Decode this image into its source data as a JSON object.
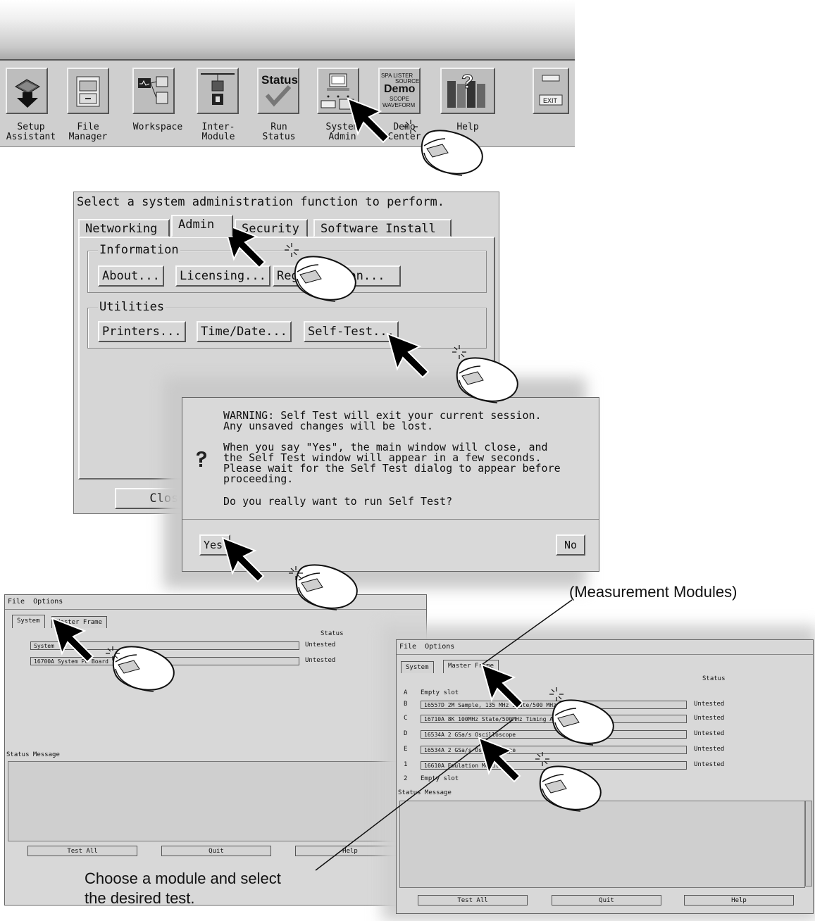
{
  "toolbar": {
    "buttons": [
      {
        "label": "Setup\nAssistant",
        "icon": "setup-assistant-icon"
      },
      {
        "label": "File\nManager",
        "icon": "file-manager-icon"
      },
      {
        "label": "Workspace",
        "icon": "workspace-icon"
      },
      {
        "label": "Inter-\nModule",
        "icon": "inter-module-icon"
      },
      {
        "label": "Run\nStatus",
        "icon": "status-icon",
        "icon_text": "Status"
      },
      {
        "label": "System\nAdmin",
        "icon": "system-admin-icon"
      },
      {
        "label": "Demo\nCenter",
        "icon": "demo-icon",
        "icon_text": "Demo",
        "icon_lines": [
          "SPA LISTER",
          "SOURCE",
          "SCOPE",
          "WAVEFORM"
        ]
      },
      {
        "label": "Help",
        "icon": "help-books-icon"
      }
    ],
    "exit_label": "EXIT"
  },
  "admin": {
    "prompt": "Select a system administration function to perform.",
    "tabs": [
      "Networking",
      "Admin",
      "Security",
      "Software Install"
    ],
    "information": {
      "title": "Information",
      "buttons": [
        "About...",
        "Licensing...",
        "Registration..."
      ]
    },
    "utilities": {
      "title": "Utilities",
      "buttons": [
        "Printers...",
        "Time/Date...",
        "Self-Test..."
      ]
    },
    "close_label": "Close"
  },
  "warning": {
    "lines1": [
      "WARNING: Self Test will exit your current session.",
      "Any unsaved changes will be lost."
    ],
    "lines2": [
      "When you say \"Yes\", the main window will close, and",
      "the Self Test window will appear in a few seconds.",
      "Please wait for the Self Test dialog to appear before",
      "proceeding."
    ],
    "question": "Do you really want to run Self Test?",
    "yes_label": "Yes",
    "no_label": "No"
  },
  "selftest_system": {
    "menu": [
      "File",
      "Options"
    ],
    "tabs": [
      "System",
      "Master Frame"
    ],
    "status_header": "Status",
    "rows": [
      {
        "name": "System",
        "status": "Untested"
      },
      {
        "name": "16700A System PC Board",
        "status": "Untested"
      }
    ],
    "status_message_label": "Status Message",
    "buttons": [
      "Test All",
      "Quit",
      "Help"
    ]
  },
  "selftest_frame": {
    "menu": [
      "File",
      "Options"
    ],
    "tabs": [
      "System",
      "Master Frame"
    ],
    "status_header": "Status",
    "slots": [
      {
        "slot": "A",
        "name": "Empty slot",
        "status": ""
      },
      {
        "slot": "B",
        "name": "16557D 2M Sample, 135 MHz State/500 MHz Timing",
        "status": "Untested"
      },
      {
        "slot": "C",
        "name": "16710A 8K 100MHz State/500MHz Timing Analyzer",
        "status": "Untested"
      },
      {
        "slot": "D",
        "name": "16534A 2 GSa/s Oscilloscope",
        "status": "Untested"
      },
      {
        "slot": "E",
        "name": "16534A 2 GSa/s Oscilloscope",
        "status": "Untested"
      },
      {
        "slot": "1",
        "name": "16610A Emulation Module",
        "status": "Untested"
      },
      {
        "slot": "2",
        "name": "Empty slot",
        "status": ""
      }
    ],
    "status_message_label": "Status Message",
    "buttons": [
      "Test All",
      "Quit",
      "Help"
    ]
  },
  "callouts": {
    "modules": "(Measurement Modules)",
    "instruction": "Choose a module and select\nthe desired test."
  }
}
